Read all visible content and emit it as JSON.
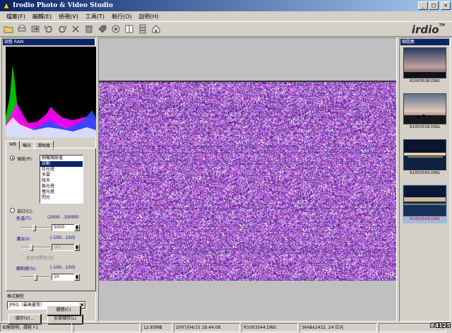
{
  "window": {
    "title": "Irodio Photo & Video Studio"
  },
  "menu": [
    "檔案(F)",
    "編輯(E)",
    "檢視(V)",
    "工具(T)",
    "執行(O)",
    "說明(H)"
  ],
  "toolbar": {
    "icons": [
      "open-folder-icon",
      "print-icon",
      "export-icon",
      "rotate-left-icon",
      "rotate-right-icon",
      "cut-icon",
      "delete-icon",
      "tag-icon",
      "color-icon",
      "split-view-icon",
      "filmstrip-icon",
      "home-icon"
    ],
    "logo": "irdio",
    "logo_tm": "TM"
  },
  "left_panel": {
    "caption": "調整 RAW",
    "tabs": [
      "WB",
      "曝光",
      "清晰度"
    ],
    "preset_label": "預設(P):",
    "presets": [
      "相機預設值",
      "自動",
      "日光燈",
      "多雲",
      "陰天",
      "鎢光燈",
      "螢光燈",
      "閃光"
    ],
    "selected_preset_index": 1,
    "custom_label": "自訂(C):",
    "temp_label": "色溫(T):",
    "temp_range": "(2000...10000)",
    "temp_value": "5050",
    "tint_label": "濃淡(I):",
    "tint_range": "(-100...100)",
    "tint_value": "-21",
    "gray_button": "設定中間色(R)",
    "saturation_label": "飽和度(S):",
    "saturation_range": "(-100...100)",
    "saturation_value": "10",
    "format_label": "格式類型",
    "format_value": "JPEG（最高畫質）",
    "save_button": "儲存(V)...",
    "save_all_button": "全部儲存(L)",
    "close_button": "關閉(C)"
  },
  "right_panel": {
    "caption": "縮圖集",
    "thumbnails": [
      {
        "name": "R1003538.DNG"
      },
      {
        "name": "R1003539.DNG"
      },
      {
        "name": "R1003543.DNG"
      },
      {
        "name": "R1003544.DNG"
      }
    ]
  },
  "status": {
    "help": "如需說明，請按 F1",
    "size": "12.85MB",
    "date": "2007/04/15 18:44:08",
    "file": "R1003544.DNG",
    "dims": "3648x2432, 24 位元"
  },
  "badge": "#4125",
  "colors": {
    "titlebar": "#0a246a",
    "selection": "#0a246a",
    "noise_purple": "#7030a0"
  }
}
